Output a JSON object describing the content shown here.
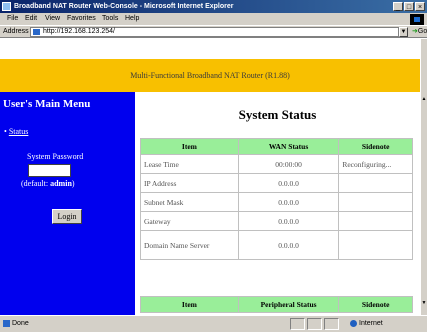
{
  "window": {
    "title": "Broadband NAT Router Web-Console - Microsoft Internet Explorer",
    "controls": [
      "_",
      "□",
      "×"
    ]
  },
  "menu": [
    "File",
    "Edit",
    "View",
    "Favorites",
    "Tools",
    "Help"
  ],
  "address": {
    "label": "Address",
    "url": "http://192.168.123.254/",
    "go_label": "Go"
  },
  "banner": {
    "text": "Multi-Functional Broadband NAT Router (R1.88)"
  },
  "sidebar": {
    "title": "User's Main Menu",
    "status_link": "Status",
    "password_label": "System Password",
    "password_value": "",
    "default_prefix": "(default: ",
    "default_value": "admin",
    "default_suffix": ")",
    "login_button": "Login"
  },
  "main": {
    "title": "System Status",
    "wan_table": {
      "headers": [
        "Item",
        "WAN Status",
        "Sidenote"
      ],
      "rows": [
        {
          "item": "Lease Time",
          "value": "00:00:00",
          "note": "Reconfiguring..."
        },
        {
          "item": "IP Address",
          "value": "0.0.0.0",
          "note": ""
        },
        {
          "item": "Subnet Mask",
          "value": "0.0.0.0",
          "note": ""
        },
        {
          "item": "Gateway",
          "value": "0.0.0.0",
          "note": ""
        },
        {
          "item": "Domain Name Server",
          "value": "0.0.0.0",
          "note": ""
        }
      ]
    },
    "peripheral_table": {
      "headers": [
        "Item",
        "Peripheral Status",
        "Sidenote"
      ]
    }
  },
  "statusbar": {
    "left": "Done",
    "zone": "Internet"
  }
}
